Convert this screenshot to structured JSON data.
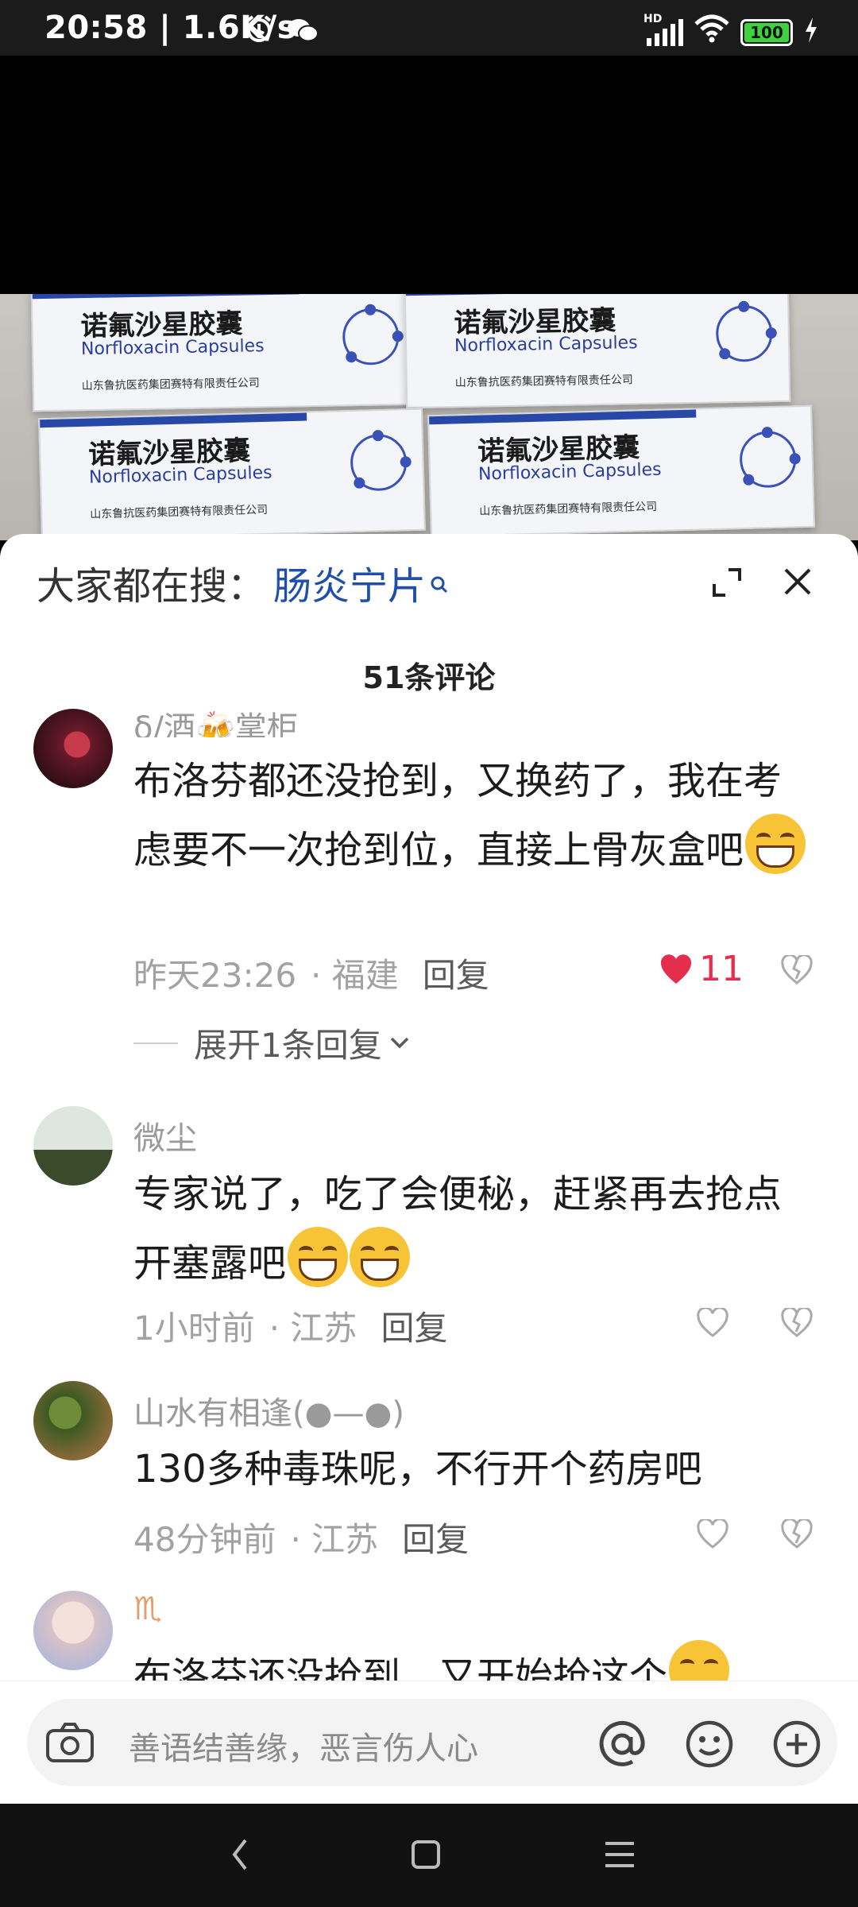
{
  "status_bar": {
    "time_speed": "20:58 | 1.6K/s",
    "network_label": "HD",
    "battery_level": "100"
  },
  "video": {
    "boxes": [
      {
        "name_cn": "诺氟沙星胶囊",
        "name_en": "Norfloxacin Capsules",
        "company": "山东鲁抗医药集团赛特有限责任公司"
      },
      {
        "name_cn": "诺氟沙星胶囊",
        "name_en": "Norfloxacin Capsules",
        "company": "山东鲁抗医药集团赛特有限责任公司"
      },
      {
        "name_cn": "诺氟沙星胶囊",
        "name_en": "Norfloxacin Capsules",
        "company": "山东鲁抗医药集团赛特有限责任公司"
      },
      {
        "name_cn": "诺氟沙星胶囊",
        "name_en": "Norfloxacin Capsules",
        "company": "山东鲁抗医药集团赛特有限责任公司"
      }
    ]
  },
  "comments_panel": {
    "search_prefix": "大家都在搜：",
    "search_keyword": "肠炎宁片",
    "comment_count": "51条评论"
  },
  "comments": [
    {
      "username": "δ/酒🍻掌柜",
      "text": "布洛芬都还没抢到，又换药了，我在考虑要不一次抢到位，直接上骨灰盒吧",
      "time": "昨天23:26",
      "location": "· 福建",
      "reply": "回复",
      "likes": "11",
      "liked": true,
      "expand": "展开1条回复"
    },
    {
      "username": "微尘",
      "text": "专家说了，吃了会便秘，赶紧再去抢点开塞露吧",
      "time": "1小时前",
      "location": "· 江苏",
      "reply": "回复"
    },
    {
      "username": "山水有相逢(●—●)",
      "text": "130多种毒珠呢，不行开个药房吧",
      "time": "48分钟前",
      "location": "· 江苏",
      "reply": "回复"
    },
    {
      "username": "♏",
      "text": "布洛芬还没抢到，又开始抢这个"
    }
  ],
  "input_bar": {
    "placeholder": "善语结善缘，恶言伤人心"
  },
  "colors": {
    "accent_keyword": "#1f4fa8",
    "like_red": "#e52e4d",
    "battery_green": "#3fd23f"
  }
}
